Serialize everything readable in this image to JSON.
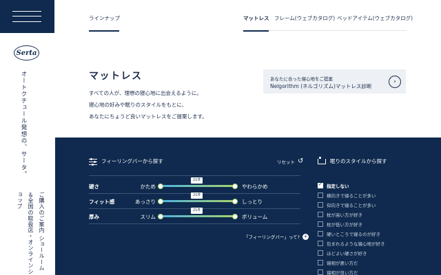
{
  "sidebar": {
    "logo": "Serta",
    "tagline": "オートクチュール発想の、サータ。",
    "store_link": "ご購入のご案内 ショールーム＆全国の取扱店・オンラインショップ"
  },
  "nav": {
    "lineup": "ラインナップ",
    "items": [
      {
        "label": "マットレス"
      },
      {
        "label": "フレーム(ウェブカタログ)"
      },
      {
        "label": "ベッドアイテム(ウェブカタログ)"
      }
    ]
  },
  "hero": {
    "title": "マットレス",
    "lines": [
      "すべての人が、理想の寝心地に出会えるように。",
      "寝心地の好みや眠りのスタイルをもとに、",
      "あなたにちょうど良いマットレスをご提案します。"
    ]
  },
  "diagnosis": {
    "small": "あなたに合った寝心地をご提案",
    "main": "Nelgorithm (ネルゴリズム)マットレス診断"
  },
  "feeling": {
    "title": "フィーリングバーから探す",
    "reset": "リセット",
    "help": "「フィーリングバー」って?",
    "rows": [
      {
        "label": "硬さ",
        "left": "かため",
        "right": "やわらかめ",
        "count": "21件"
      },
      {
        "label": "フィット感",
        "left": "あっさり",
        "right": "しっとり",
        "count": "21件"
      },
      {
        "label": "厚み",
        "left": "スリム",
        "right": "ボリューム",
        "count": "21件"
      }
    ]
  },
  "sleep_style": {
    "title": "眠りのスタイルから探す",
    "options": [
      {
        "label": "指定しない",
        "checked": true
      },
      {
        "label": "横向きで寝ることが多い",
        "checked": false
      },
      {
        "label": "仰向きで寝ることが多い",
        "checked": false
      },
      {
        "label": "枕が高い方が好き",
        "checked": false
      },
      {
        "label": "枕が低い方が好き",
        "checked": false
      },
      {
        "label": "硬いところで寝るのが好き",
        "checked": false
      },
      {
        "label": "包まれるような寝心地が好き",
        "checked": false
      },
      {
        "label": "ほどよい硬さが好き",
        "checked": false
      },
      {
        "label": "寝相が悪い方だ",
        "checked": false
      },
      {
        "label": "寝相が良い方だ",
        "checked": false
      }
    ]
  }
}
